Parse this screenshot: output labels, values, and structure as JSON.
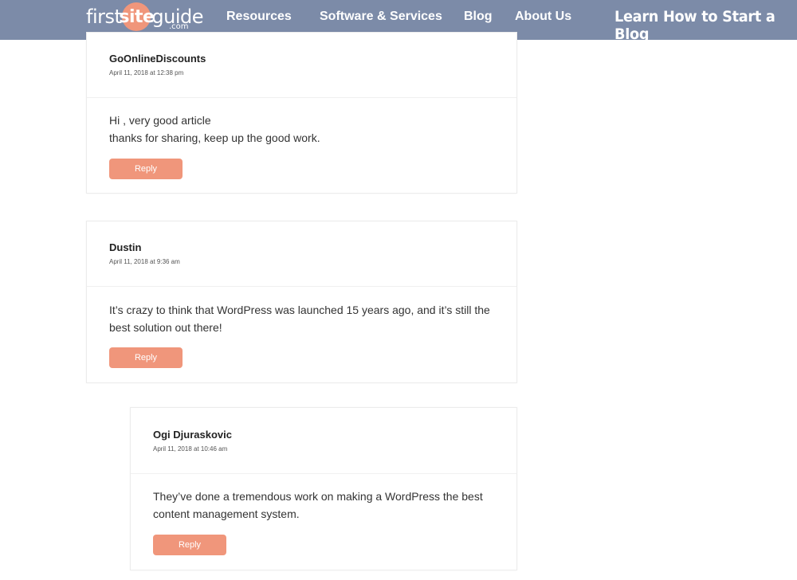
{
  "brand": {
    "logo_first": "first",
    "logo_site": "site",
    "logo_guide": "guide",
    "logo_com": ".com",
    "accent_color": "#f0967b",
    "nav_color": "#7c8ba8"
  },
  "nav": {
    "items": [
      {
        "label": "Resources"
      },
      {
        "label": "Software & Services"
      },
      {
        "label": "Blog"
      },
      {
        "label": "About Us"
      }
    ],
    "cta_label": "Learn How to Start a Blog"
  },
  "comments": [
    {
      "author": "GoOnlineDiscounts",
      "date": "April 11, 2018 at 12:38 pm",
      "lines": [
        "Hi , very good article",
        "thanks for sharing, keep up the good work."
      ],
      "reply_label": "Reply"
    },
    {
      "author": "Dustin",
      "date": "April 11, 2018 at 9:36 am",
      "lines": [
        "It’s crazy to think that WordPress was launched 15 years ago, and it’s still the",
        "best solution out there!"
      ],
      "reply_label": "Reply"
    },
    {
      "author": "Ogi Djuraskovic",
      "date": "April 11, 2018 at 10:46 am",
      "lines": [
        "They’ve done a tremendous work on making a WordPress the best",
        "content management system."
      ],
      "reply_label": "Reply"
    }
  ]
}
